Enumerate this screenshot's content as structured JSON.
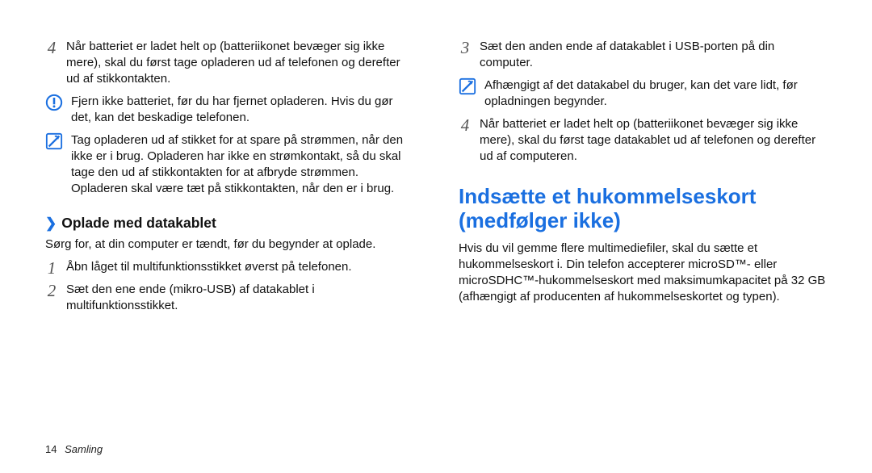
{
  "left": {
    "step4": "Når batteriet er ladet helt op (batteriikonet bevæger sig ikke mere), skal du først tage opladeren ud af telefonen og derefter ud af stikkontakten.",
    "warn": "Fjern ikke batteriet, før du har fjernet opladeren. Hvis du gør det, kan det beskadige telefonen.",
    "info": "Tag opladeren ud af stikket for at spare på strømmen, når den ikke er i brug. Opladeren har ikke en strømkontakt, så du skal tage den ud af stikkontakten for at afbryde strømmen. Opladeren skal være tæt på stikkontakten, når den er i brug.",
    "subhead": "Oplade med datakablet",
    "intro": "Sørg for, at din computer er tændt, før du begynder at oplade.",
    "s1": "Åbn låget til multifunktionsstikket øverst på telefonen.",
    "s2": "Sæt den ene ende (mikro-USB) af datakablet i multifunktionsstikket."
  },
  "right": {
    "s3": "Sæt den anden ende af datakablet i USB-porten på din computer.",
    "info": "Afhængigt af det datakabel du bruger, kan det vare lidt, før opladningen begynder.",
    "s4": "Når batteriet er ladet helt op (batteriikonet bevæger sig ikke mere), skal du først tage datakablet ud af telefonen og derefter ud af computeren.",
    "title": "Indsætte et hukommelseskort (medfølger ikke)",
    "body": "Hvis du vil gemme flere multimediefiler, skal du sætte et hukommelseskort i. Din telefon accepterer microSD™- eller microSDHC™-hukommelseskort med maksimumkapacitet på 32 GB (afhængigt af producenten af hukommelseskortet og typen)."
  },
  "footer": {
    "page": "14",
    "section": "Samling"
  },
  "steps": {
    "n1": "1",
    "n2": "2",
    "n3": "3",
    "n4": "4"
  }
}
